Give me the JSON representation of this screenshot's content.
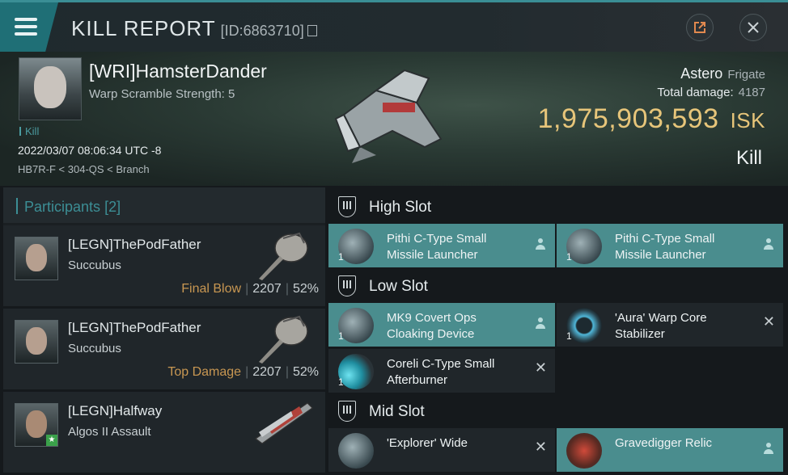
{
  "header": {
    "title": "KILL REPORT",
    "report_id": "[ID:6863710]"
  },
  "victim": {
    "name": "[WRI]HamsterDander",
    "warp_scramble": "Warp Scramble Strength: 5",
    "tag": "Kill",
    "date": "2022/03/07 08:06:34 UTC -8",
    "location": "HB7R-F < 304-QS < Branch",
    "ship": "Astero",
    "ship_class": "Frigate",
    "total_damage_label": "Total damage:",
    "total_damage": "4187",
    "isk_value": "1,975,903,593",
    "isk_unit": "ISK",
    "result": "Kill"
  },
  "participants": {
    "label": "Participants",
    "count": "[2]",
    "rows": [
      {
        "name": "[LEGN]ThePodFather",
        "ship": "Succubus",
        "tag": "Final Blow",
        "damage": "2207",
        "percent": "52%"
      },
      {
        "name": "[LEGN]ThePodFather",
        "ship": "Succubus",
        "tag": "Top Damage",
        "damage": "2207",
        "percent": "52%"
      },
      {
        "name": "[LEGN]Halfway",
        "ship": "Algos II Assault",
        "tag": "",
        "damage": "",
        "percent": ""
      }
    ]
  },
  "slots": {
    "high": {
      "label": "High Slot",
      "items": [
        {
          "qty": "1",
          "name": "Pithi C-Type Small Missile Launcher",
          "status": "dropped"
        },
        {
          "qty": "1",
          "name": "Pithi C-Type Small Missile Launcher",
          "status": "dropped"
        }
      ]
    },
    "low": {
      "label": "Low Slot",
      "items": [
        {
          "qty": "1",
          "name": "MK9 Covert Ops Cloaking Device",
          "status": "dropped"
        },
        {
          "qty": "1",
          "name": "'Aura' Warp Core Stabilizer",
          "status": "destroyed"
        },
        {
          "qty": "1",
          "name": "Coreli C-Type Small Afterburner",
          "status": "destroyed"
        }
      ]
    },
    "mid": {
      "label": "Mid Slot",
      "items": [
        {
          "qty": "",
          "name": "'Explorer' Wide",
          "status": "destroyed"
        },
        {
          "qty": "",
          "name": "Gravedigger Relic",
          "status": "dropped"
        }
      ]
    }
  },
  "colors": {
    "accent": "#3a8e95",
    "isk": "#e7c57a",
    "dropped": "#4a8d8e",
    "tag": "#c89752"
  }
}
